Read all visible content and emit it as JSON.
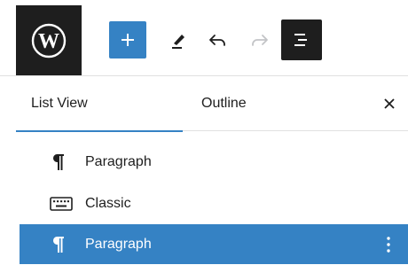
{
  "toolbar": {
    "logo_icon": "wordpress-icon",
    "add_icon": "plus-icon",
    "edit_icon": "pencil-icon",
    "undo_icon": "undo-icon",
    "redo_icon": "redo-icon",
    "list_view_icon": "list-view-icon",
    "accent_color": "#3582c4"
  },
  "tabs": {
    "list_view": "List View",
    "outline": "Outline",
    "close_icon": "close-icon"
  },
  "list": {
    "items": [
      {
        "label": "Paragraph",
        "icon": "paragraph-icon",
        "selected": false
      },
      {
        "label": "Classic",
        "icon": "keyboard-icon",
        "selected": false
      },
      {
        "label": "Paragraph",
        "icon": "paragraph-icon",
        "selected": true,
        "menu_icon": "more-vertical-icon"
      }
    ],
    "selected_color": "#3582c4"
  }
}
